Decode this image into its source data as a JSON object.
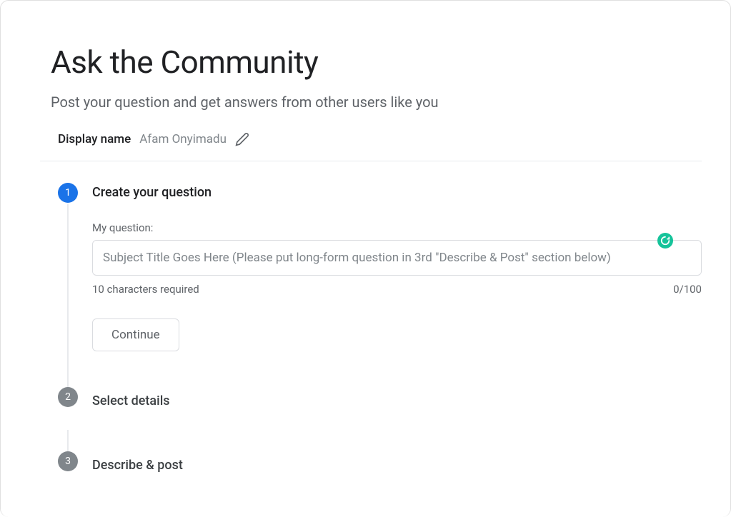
{
  "header": {
    "title": "Ask the Community",
    "subtitle": "Post your question and get answers from other users like you"
  },
  "displayName": {
    "label": "Display name",
    "value": "Afam Onyimadu"
  },
  "steps": {
    "step1": {
      "number": "1",
      "title": "Create your question",
      "fieldLabel": "My question:",
      "placeholder": "Subject Title Goes Here (Please put long-form question in 3rd \"Describe & Post\" section below)",
      "helperText": "10 characters required",
      "counter": "0/100",
      "continueLabel": "Continue"
    },
    "step2": {
      "number": "2",
      "title": "Select details"
    },
    "step3": {
      "number": "3",
      "title": "Describe & post"
    }
  }
}
